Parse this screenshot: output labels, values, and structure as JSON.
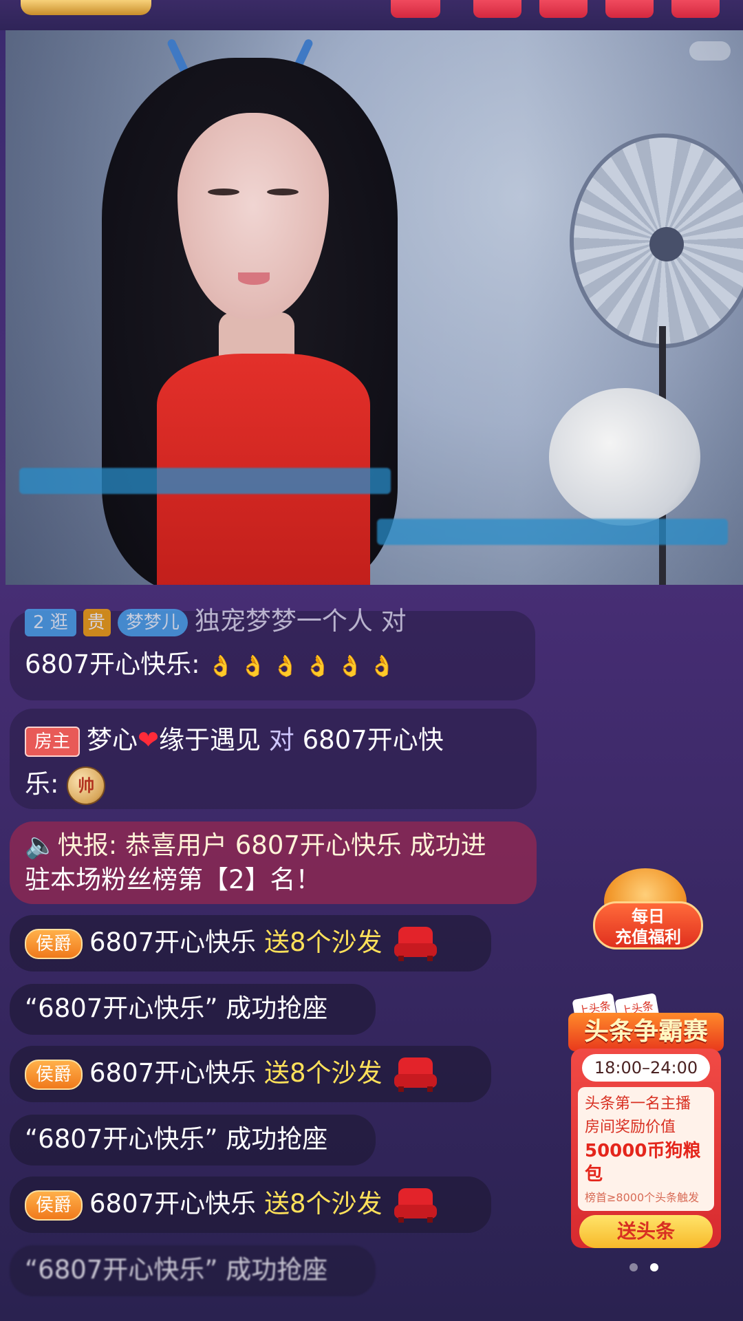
{
  "chat": {
    "msg1": {
      "tag_blue": "2 逛",
      "tag_gold": "贵",
      "tag_fans": "梦梦儿",
      "user": "独宠梦梦一个人",
      "to": "对",
      "target": "6807开心快乐:",
      "emojis": "👌 👌 👌 👌 👌 👌"
    },
    "msg2": {
      "tag": "房主",
      "user": "梦心",
      "heart": "❤",
      "user_rest": "缘于遇见",
      "to": "对",
      "target": "6807开心快",
      "target2": "乐:",
      "coin": "帅"
    },
    "msg3": {
      "icon": "🔈",
      "text": "快报: 恭喜用户 6807开心快乐 成功进",
      "text2": "驻本场粉丝榜第【2】名！"
    },
    "gift": {
      "tag": "侯爵",
      "user": "6807开心快乐",
      "action": "送8个沙发"
    },
    "seat_text": "“6807开心快乐” 成功抢座"
  },
  "widgets": {
    "daily_line1": "每日",
    "daily_line2": "充值福利",
    "headline_title": "头条争霸赛",
    "sticker1": "上头条",
    "sticker2": "上头条",
    "time": "18:00–24:00",
    "desc1": "头条第一名主播",
    "desc2": "房间奖励价值",
    "reward": "50000币狗粮包",
    "note": "榜首≥8000个头条触发",
    "button": "送头条"
  }
}
